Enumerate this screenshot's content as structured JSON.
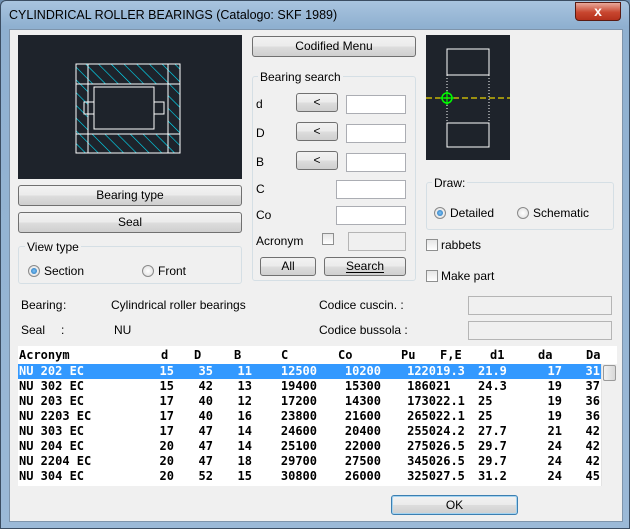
{
  "window": {
    "title": "CYLINDRICAL ROLLER BEARINGS (Catalogo: SKF 1989)",
    "close_glyph": "x"
  },
  "buttons": {
    "bearing_type": "Bearing type",
    "seal": "Seal",
    "codified_menu": "Codified Menu",
    "all": "All",
    "search": "Search",
    "ok": "OK",
    "arrow": "<"
  },
  "view_type": {
    "label": "View type",
    "section": "Section",
    "front": "Front",
    "selected": "Section"
  },
  "bearing_search": {
    "label": "Bearing search",
    "d": "d",
    "D": "D",
    "B": "B",
    "C": "C",
    "Co": "Co",
    "acronym": "Acronym",
    "d_value": "",
    "D_value": "",
    "B_value": "",
    "C_value": "",
    "Co_value": "",
    "acronym_value": ""
  },
  "draw": {
    "label": "Draw:",
    "detailed": "Detailed",
    "schematic": "Schematic",
    "selected": "Detailed"
  },
  "options": {
    "rabbets": "rabbets",
    "make_part": "Make part"
  },
  "info": {
    "bearing_label": "Bearing",
    "bearing_sep": ":",
    "bearing_value": "Cylindrical roller bearings",
    "seal_label": "Seal",
    "seal_sep": ":",
    "seal_value": "NU",
    "codice_cuscin_label": "Codice cuscin. :",
    "codice_bussola_label": "Codice bussola :",
    "codice_cuscin_value": "",
    "codice_bussola_value": ""
  },
  "table": {
    "columns": [
      "Acronym",
      "d",
      "D",
      "B",
      "C",
      "Co",
      "Pu",
      "F,E",
      "d1",
      "da",
      "Da"
    ],
    "rows": [
      [
        "NU 202 EC",
        "15",
        "35",
        "11",
        "12500",
        "10200",
        "1220",
        "19.3",
        "21.9",
        "17",
        "31"
      ],
      [
        "NU 302 EC",
        "15",
        "42",
        "13",
        "19400",
        "15300",
        "1860",
        "21",
        "24.3",
        "19",
        "37"
      ],
      [
        "NU 203 EC",
        "17",
        "40",
        "12",
        "17200",
        "14300",
        "1730",
        "22.1",
        "25",
        "19",
        "36"
      ],
      [
        "NU 2203 EC",
        "17",
        "40",
        "16",
        "23800",
        "21600",
        "2650",
        "22.1",
        "25",
        "19",
        "36"
      ],
      [
        "NU 303 EC",
        "17",
        "47",
        "14",
        "24600",
        "20400",
        "2550",
        "24.2",
        "27.7",
        "21",
        "42"
      ],
      [
        "NU 204 EC",
        "20",
        "47",
        "14",
        "25100",
        "22000",
        "2750",
        "26.5",
        "29.7",
        "24",
        "42"
      ],
      [
        "NU 2204 EC",
        "20",
        "47",
        "18",
        "29700",
        "27500",
        "3450",
        "26.5",
        "29.7",
        "24",
        "42"
      ],
      [
        "NU 304 EC",
        "20",
        "52",
        "15",
        "30800",
        "26000",
        "3250",
        "27.5",
        "31.2",
        "24",
        "45"
      ]
    ],
    "selected_row": 0
  },
  "colors": {
    "selection": "#3399ff",
    "canvas_bg": "#1e232b",
    "hatch": "#00e5ff",
    "axis": "#e6d200",
    "marker": "#00ff00"
  }
}
